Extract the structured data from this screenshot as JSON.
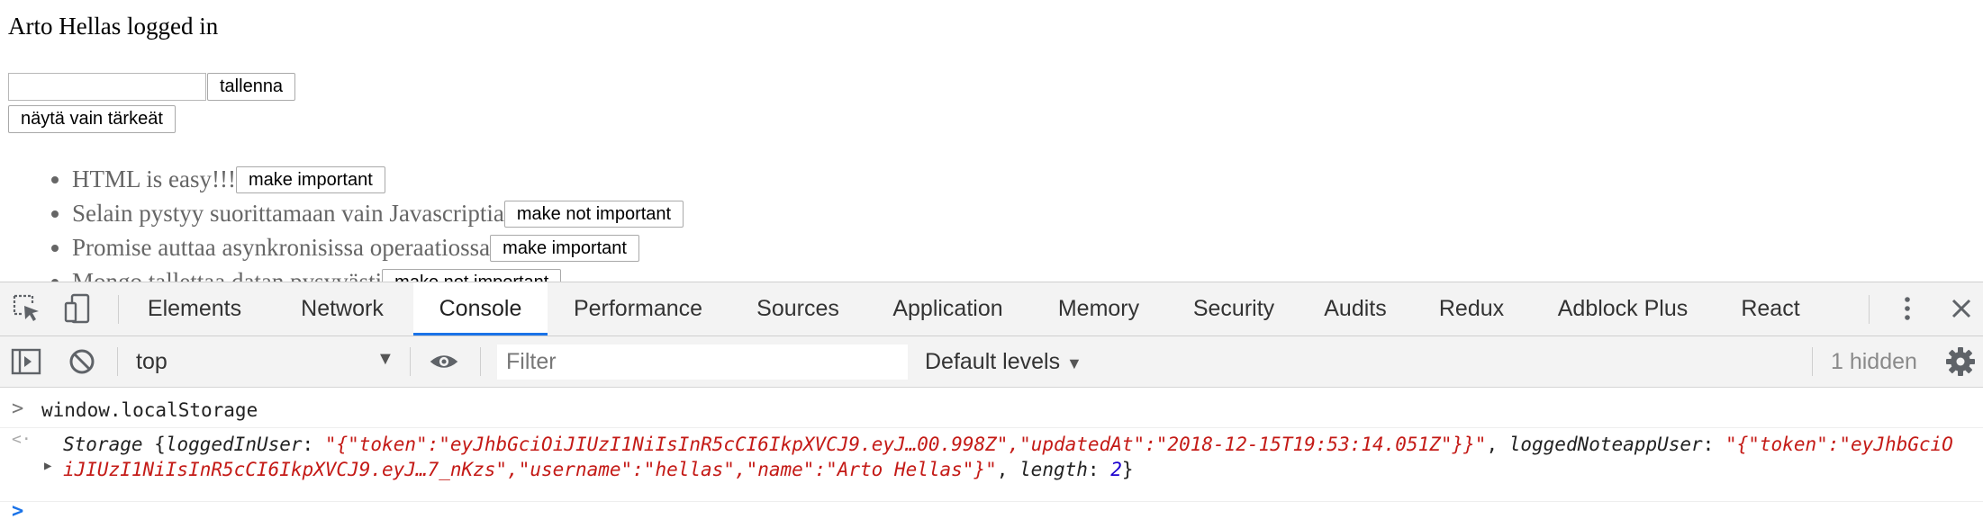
{
  "app": {
    "status_text": "Arto Hellas logged in",
    "note_input": {
      "value": "",
      "placeholder": ""
    },
    "save_label": "tallenna",
    "filter_label": "näytä vain tärkeät",
    "notes": [
      {
        "text": "HTML is easy!!!",
        "button": "make important"
      },
      {
        "text": "Selain pystyy suorittamaan vain Javascriptia",
        "button": "make not important"
      },
      {
        "text": "Promise auttaa asynkronisissa operaatiossa",
        "button": "make important"
      },
      {
        "text": "Mongo tallettaa datan pysyvästi",
        "button": "make not important"
      }
    ]
  },
  "devtools": {
    "tabs": [
      {
        "label": "Elements",
        "active": false
      },
      {
        "label": "Network",
        "active": false
      },
      {
        "label": "Console",
        "active": true
      },
      {
        "label": "Performance",
        "active": false
      },
      {
        "label": "Sources",
        "active": false
      },
      {
        "label": "Application",
        "active": false
      },
      {
        "label": "Memory",
        "active": false
      },
      {
        "label": "Security",
        "active": false
      },
      {
        "label": "Audits",
        "active": false
      },
      {
        "label": "Redux",
        "active": false
      },
      {
        "label": "Adblock Plus",
        "active": false
      },
      {
        "label": "React",
        "active": false
      }
    ],
    "icons": {
      "inspect": "inspect-element-icon",
      "device": "device-toolbar-icon",
      "more": "more-vertical-icon",
      "close": "close-icon",
      "sidebar": "console-sidebar-icon",
      "clear": "clear-console-icon",
      "eye": "live-expression-eye-icon",
      "settings": "gear-icon"
    },
    "toolbar": {
      "context": "top",
      "filter_placeholder": "Filter",
      "levels": "Default levels",
      "hidden": "1 hidden"
    },
    "console": {
      "input_prompt": ">",
      "command": "window.localStorage",
      "result_prompt": "<·",
      "result": {
        "type": "Storage",
        "brace_open": "{",
        "key1": "loggedInUser",
        "value1": "\"{\"token\":\"eyJhbGciOiJIUzI1NiIsInR5cCI6IkpXVCJ9.eyJ…00.998Z\",\"updatedAt\":\"2018-12-15T19:53:14.051Z\"}}\"",
        "key2": "loggedNoteappUser",
        "value2": "\"{\"token\":\"eyJhbGciOiJIUzI1NiIsInR5cCI6IkpXVCJ9.eyJ…7_nKzs\",\"username\":\"hellas\",\"name\":\"Arto Hellas\"}\"",
        "key3": "length",
        "value3": "2",
        "brace_close": "}"
      },
      "empty_prompt": ">"
    },
    "colors": {
      "accent": "#1a73e8",
      "string": "#c41a16",
      "number": "#1c00cf"
    }
  }
}
